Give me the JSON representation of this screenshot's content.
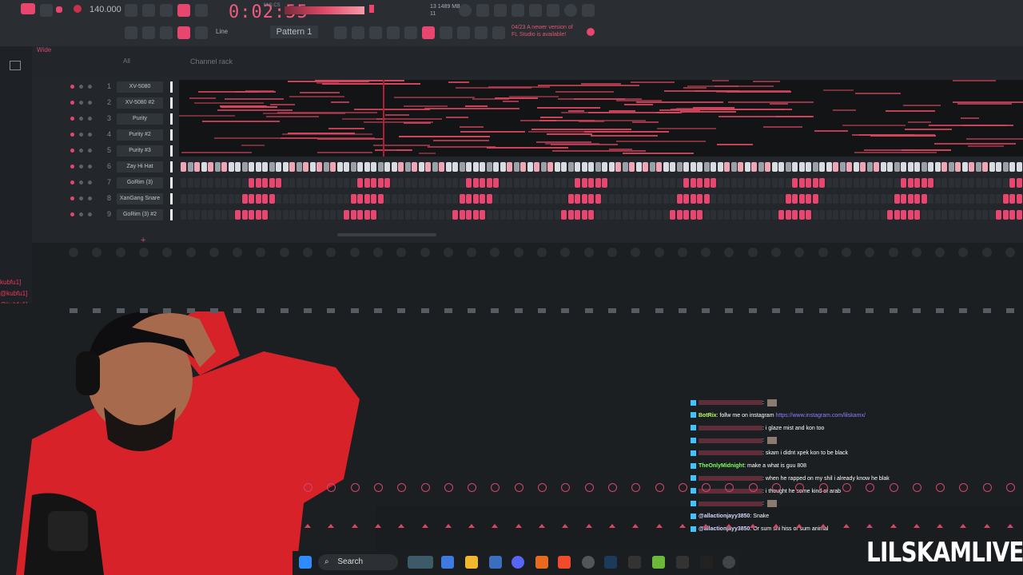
{
  "toolbar": {
    "tempo": "140.000",
    "time": "0:02:55",
    "time_label": "M:S:CS",
    "cpu_line1": "13   1489 MB",
    "cpu_line2": "11",
    "pattern": "Pattern 1",
    "snap": "Line",
    "news_line1": "04/23  A newer version of",
    "news_line2": "FL Studio is available!",
    "accent": "#e8466e"
  },
  "channel_rack": {
    "title": "Channel rack",
    "filter": "All",
    "wide": "Wide",
    "channels": [
      {
        "num": "1",
        "name": "XV-5080"
      },
      {
        "num": "2",
        "name": "XV-5080 #2"
      },
      {
        "num": "3",
        "name": "Purity"
      },
      {
        "num": "4",
        "name": "Purity #2"
      },
      {
        "num": "5",
        "name": "Purity #3"
      },
      {
        "num": "6",
        "name": "Zay Hi Hat"
      },
      {
        "num": "7",
        "name": "GoRim (3)"
      },
      {
        "num": "8",
        "name": "XanGang Snare"
      },
      {
        "num": "9",
        "name": "GoRim (3) #2"
      }
    ],
    "add_label": "+"
  },
  "left_chat": [
    "kubfu1]",
    "@kubfu1]",
    "@kubfu1]"
  ],
  "chat": [
    {
      "user": "",
      "msg": ":",
      "user_color": "#ff3b5c",
      "emote": true
    },
    {
      "user": "BotRix",
      "msg": ": follw me on instagram ",
      "link": "https://www.instagram.com/lilskamx/",
      "user_color": "#b8ff5a"
    },
    {
      "user": "",
      "msg": ": i glaze mist and kon too",
      "user_color": "#ff3b5c"
    },
    {
      "user": "",
      "msg": ":",
      "user_color": "#ff3b5c",
      "emote": true
    },
    {
      "user": "",
      "msg": ": skam i didnt xpek kon to be black",
      "user_color": "#ff3b5c"
    },
    {
      "user": "TheOnlyMidnight",
      "msg": ": make a what is guu 808",
      "user_color": "#7dff5a"
    },
    {
      "user": "",
      "msg": ": when he rapped on my shil i already know he blak",
      "user_color": "#ff3b5c"
    },
    {
      "user": "",
      "msg": ": i thought he some kind of arab",
      "user_color": "#ff3b5c"
    },
    {
      "user": "",
      "msg": ":",
      "user_color": "#ff3b5c",
      "emote": true
    },
    {
      "user": "@allactionjayy3850",
      "msg": ": Snake",
      "user_color": "#d8d8ff"
    },
    {
      "user": "@allactionjayy3850",
      "msg": ": Or sum shi hiss or sum animal",
      "user_color": "#d8d8ff"
    }
  ],
  "taskbar": {
    "search": "Search"
  },
  "watermark": "LILSKAMLIVE"
}
